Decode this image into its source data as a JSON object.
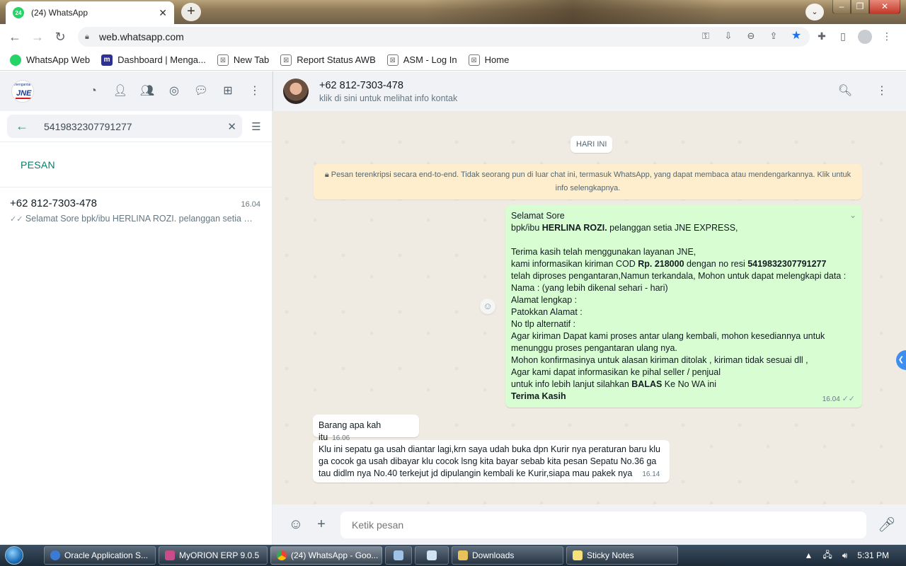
{
  "browser": {
    "tab_title": "(24) WhatsApp",
    "tab_badge": "24",
    "url": "web.whatsapp.com",
    "bookmarks": [
      "WhatsApp Web",
      "Dashboard | Menga...",
      "New Tab",
      "Report Status AWB",
      "ASM - Log In",
      "Home"
    ]
  },
  "sidebar": {
    "logo_text_top": "mengantar",
    "logo_text": "JNE",
    "search_value": "5419832307791277",
    "section_label": "PESAN",
    "results": [
      {
        "name": "+62 812-7303-478",
        "time": "16.04",
        "preview": "Selamat Sore  bpk/ibu HERLINA ROZI. pelanggan setia JNE EXPRESS,"
      }
    ]
  },
  "chat": {
    "contact_name": "+62 812-7303-478",
    "contact_sub": "klik di sini untuk melihat info kontak",
    "date_chip": "HARI INI",
    "encryption_notice": "Pesan terenkripsi secara end-to-end. Tidak seorang pun di luar chat ini, termasuk WhatsApp, yang dapat membaca atau mendengarkannya. Klik untuk info selengkapnya.",
    "outgoing": {
      "time": "16.04",
      "l1": "Selamat Sore",
      "l2a": " bpk/ibu ",
      "l2b": "HERLINA ROZI.",
      "l2c": " pelanggan setia JNE EXPRESS,",
      "l3": "Terima kasih telah menggunakan layanan JNE,",
      "l4a": "kami informasikan kiriman  COD ",
      "l4b": "Rp. 218000",
      "l4c": " dengan no resi ",
      "l4d": "5419832307791277",
      "l5": "telah diproses pengantaran,Namun terkandala, Mohon untuk dapat melengkapi data :",
      "l6": "Nama : (yang lebih dikenal sehari - hari)",
      "l7": "Alamat  lengkap :",
      "l8": "Patokkan Alamat :",
      "l9": "No tlp alternatif :",
      "l10": "Agar kiriman Dapat kami proses antar ulang kembali, mohon kesediannya untuk",
      "l11": "menunggu proses pengantaran ulang nya.",
      "l12": "Mohon konfirmasinya untuk alasan kiriman ditolak , kiriman tidak sesuai dll ,",
      "l13": "Agar kami dapat informasikan ke pihal seller / penjual",
      "l14a": "untuk info lebih lanjut silahkan ",
      "l14b": "BALAS",
      "l14c": " Ke No WA ini",
      "l15": "Terima Kasih"
    },
    "incoming": [
      {
        "text": "Barang apa kah itu",
        "time": "16.06"
      },
      {
        "line1": "Klu ini sepatu ga usah diantar lagi,krn saya udah buka dpn Kurir nya peraturan baru klu",
        "line2": "ga cocok ga usah dibayar klu cocok lsng kita bayar sebab kita pesan Sepatu No.36 ga",
        "line3": "tau didlm nya No.40 terkejut jd dipulangin kembali ke Kurir,siapa mau pakek nya",
        "time": "16.14"
      }
    ],
    "composer_placeholder": "Ketik pesan"
  },
  "taskbar": {
    "items": [
      "Oracle Application S...",
      "MyORION ERP 9.0.5",
      "(24) WhatsApp - Goo...",
      "Downloads",
      "Sticky Notes"
    ],
    "clock": "5:31 PM"
  },
  "colors": {
    "wa_green": "#00a884",
    "outgoing_bubble": "#d9fdd3",
    "chat_bg": "#efeae2"
  }
}
